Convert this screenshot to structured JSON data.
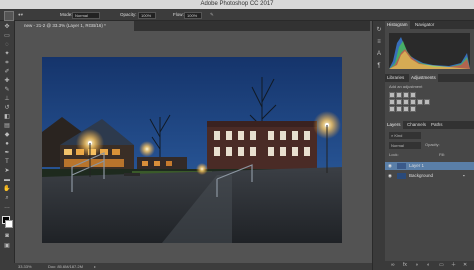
{
  "app": {
    "title": "Adobe Photoshop CC 2017"
  },
  "options_bar": {
    "mode_label": "Mode:",
    "mode_value": "Normal",
    "opacity_label": "Opacity:",
    "opacity_value": "100%",
    "flow_label": "Flow:",
    "flow_value": "100%"
  },
  "document": {
    "tab_label": "new - 21-2 @ 33.3% (Layer 1, RGB/16) *",
    "zoom": "33.33%",
    "doc_info": "Doc: 85.6M/187.2M"
  },
  "panels": {
    "top_tabs": [
      "Histogram",
      "Navigator"
    ],
    "mid_tabs": [
      "Libraries",
      "Adjustments"
    ],
    "add_adjustment": "Add an adjustment",
    "layer_tabs": [
      "Layers",
      "Channels",
      "Paths"
    ],
    "kind_label": "Kind",
    "mode_value": "Normal",
    "opacity_label": "Opacity:",
    "fill_label": "Fill:",
    "lock_label": "Lock:",
    "layers": [
      "Layer 1",
      "Background"
    ]
  },
  "colors": {
    "sky": "#1e3f7a",
    "accent": "#3a6ea5"
  }
}
